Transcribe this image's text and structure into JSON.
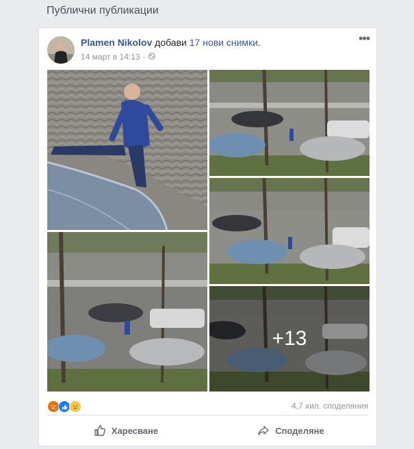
{
  "section": {
    "title": "Публични публикации"
  },
  "post": {
    "author": "Plamen Nikolov",
    "action_text": "добави",
    "photo_count_text": "17 нови снимки",
    "period": ".",
    "timestamp": "14 март в 14:13",
    "separator": "·",
    "privacy_icon": "globe-icon",
    "more_icon": "more-options-icon",
    "more_overlay": "+13",
    "shares": "4,7 хил. споделяния",
    "reactions": [
      "angry-reaction-icon",
      "like-reaction-icon",
      "sad-reaction-icon"
    ],
    "actions": {
      "like": "Харесване",
      "share": "Споделяне"
    }
  },
  "colors": {
    "link": "#365899",
    "meta": "#90949c",
    "page_bg": "#e9ebee"
  }
}
